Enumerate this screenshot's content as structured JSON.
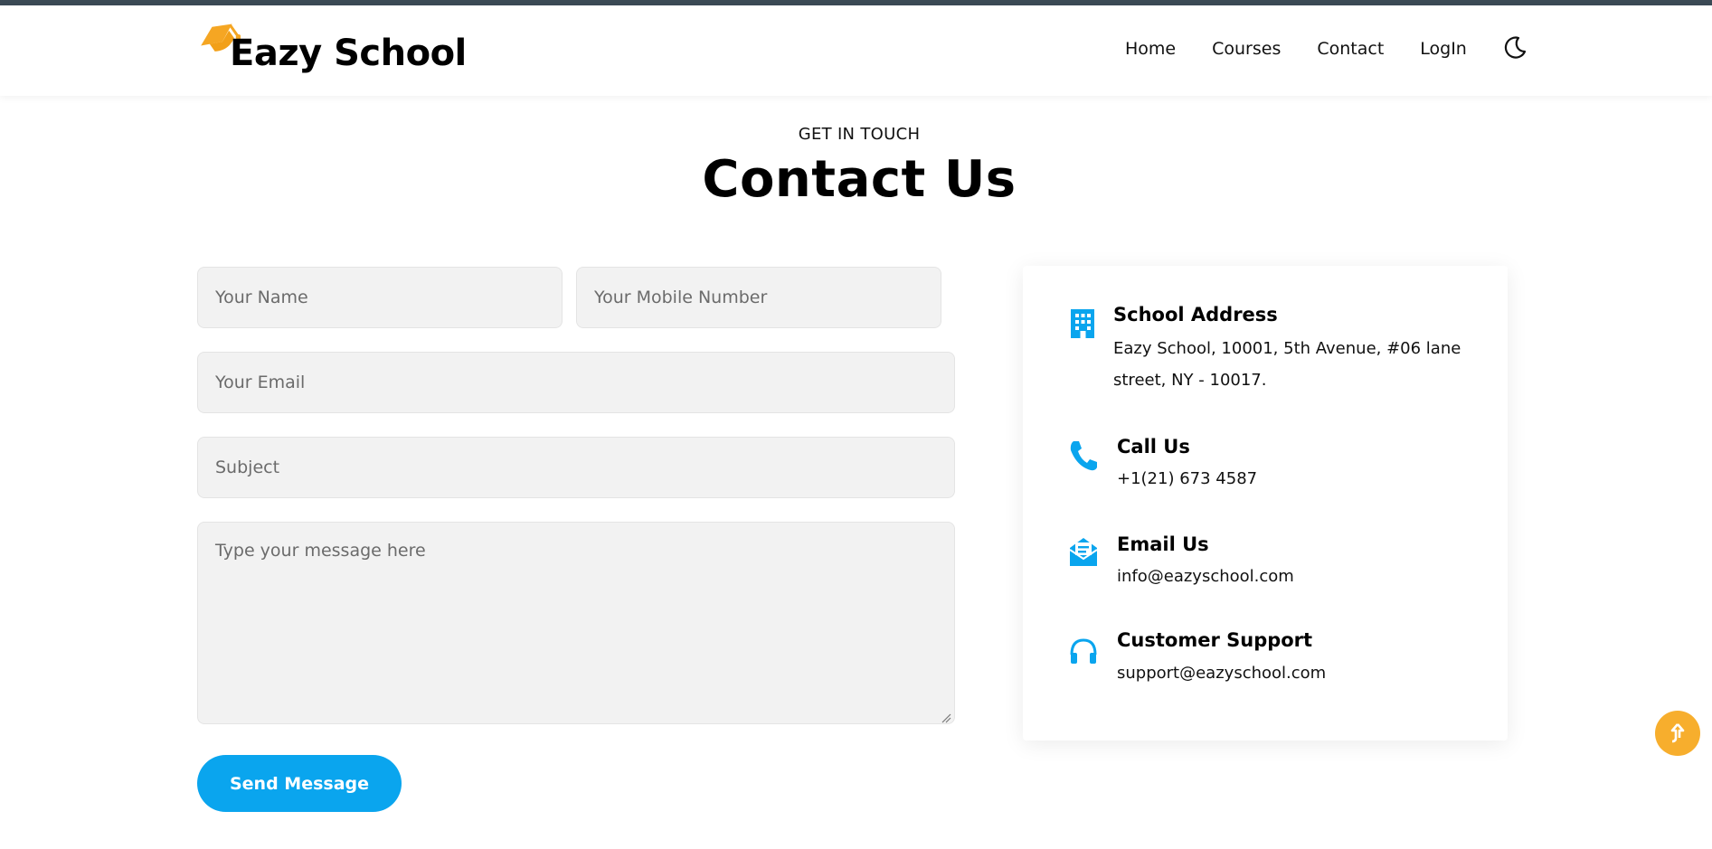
{
  "brand": {
    "name": "Eazy School",
    "logo_icon": "graduation-cap-icon",
    "accent": "#f5a623"
  },
  "nav": {
    "items": [
      {
        "label": "Home"
      },
      {
        "label": "Courses"
      },
      {
        "label": "Contact"
      },
      {
        "label": "LogIn"
      }
    ],
    "theme_toggle_icon": "moon-icon"
  },
  "hero": {
    "eyebrow": "GET IN TOUCH",
    "title": "Contact Us"
  },
  "form": {
    "name_placeholder": "Your Name",
    "mobile_placeholder": "Your Mobile Number",
    "email_placeholder": "Your Email",
    "subject_placeholder": "Subject",
    "message_placeholder": "Type your message here",
    "submit_label": "Send Message",
    "submit_color": "#0aa5ee"
  },
  "contact_info": {
    "icon_color": "#0aa5ee",
    "items": [
      {
        "icon": "building-icon",
        "label": "School Address",
        "lines": [
          "Eazy School, 10001, 5th Avenue, #06 lane",
          "street, NY - 10017."
        ]
      },
      {
        "icon": "phone-icon",
        "label": "Call Us",
        "lines": [
          "+1(21) 673 4587"
        ]
      },
      {
        "icon": "envelope-open-icon",
        "label": "Email Us",
        "lines": [
          "info@eazyschool.com"
        ]
      },
      {
        "icon": "headset-icon",
        "label": "Customer Support",
        "lines": [
          "support@eazyschool.com"
        ]
      }
    ]
  },
  "scroll_top": {
    "icon": "arrow-up-icon",
    "color": "#f7ae2d"
  }
}
